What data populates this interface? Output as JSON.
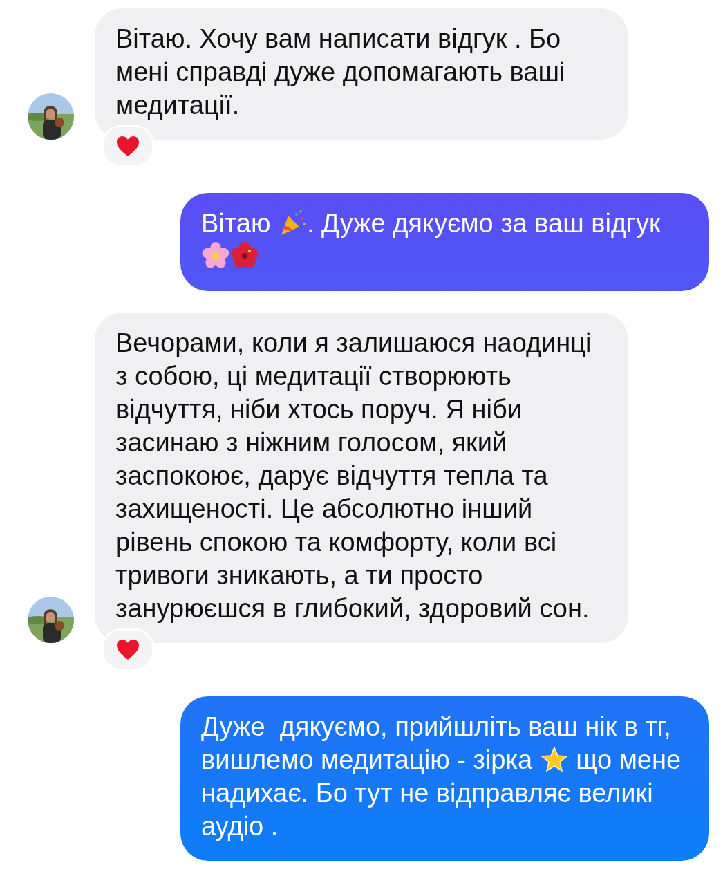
{
  "messages": [
    {
      "kind": "incoming",
      "avatar": true,
      "reacted": true,
      "parts": [
        {
          "kind": "text",
          "text": "Вітаю. Хочу вам написати відгук . Бо мені справді дуже допомагають ваші медитації."
        }
      ]
    },
    {
      "kind": "outgoing",
      "parts": [
        {
          "kind": "text",
          "text": "Вітаю "
        },
        {
          "kind": "popper"
        },
        {
          "kind": "text",
          "text": ". Дуже дякуємо за ваш відгук "
        },
        {
          "kind": "blossom"
        },
        {
          "kind": "hibiscus"
        }
      ]
    },
    {
      "kind": "incoming",
      "avatar": true,
      "reacted": true,
      "parts": [
        {
          "kind": "text",
          "text": "Вечорами, коли я залишаюся наодинці з собою, ці медитації створюють відчуття, ніби хтось поруч. Я ніби засинаю з ніжним голосом, який заспокоює, дарує відчуття тепла та захищеності. Це абсолютно інший рівень спокою та комфорту, коли всі тривоги зникають, а ти просто занурюєшся в глибокий, здоровий сон."
        }
      ]
    },
    {
      "kind": "outgoing",
      "parts": [
        {
          "kind": "text",
          "text": "Дуже  дякуємо, прийшліть ваш нік в тг, вишлемо медитацію - зірка "
        },
        {
          "kind": "star"
        },
        {
          "kind": "text",
          "text": " що мене надихає. Бо тут не відправляє великі аудіо ."
        }
      ]
    }
  ]
}
